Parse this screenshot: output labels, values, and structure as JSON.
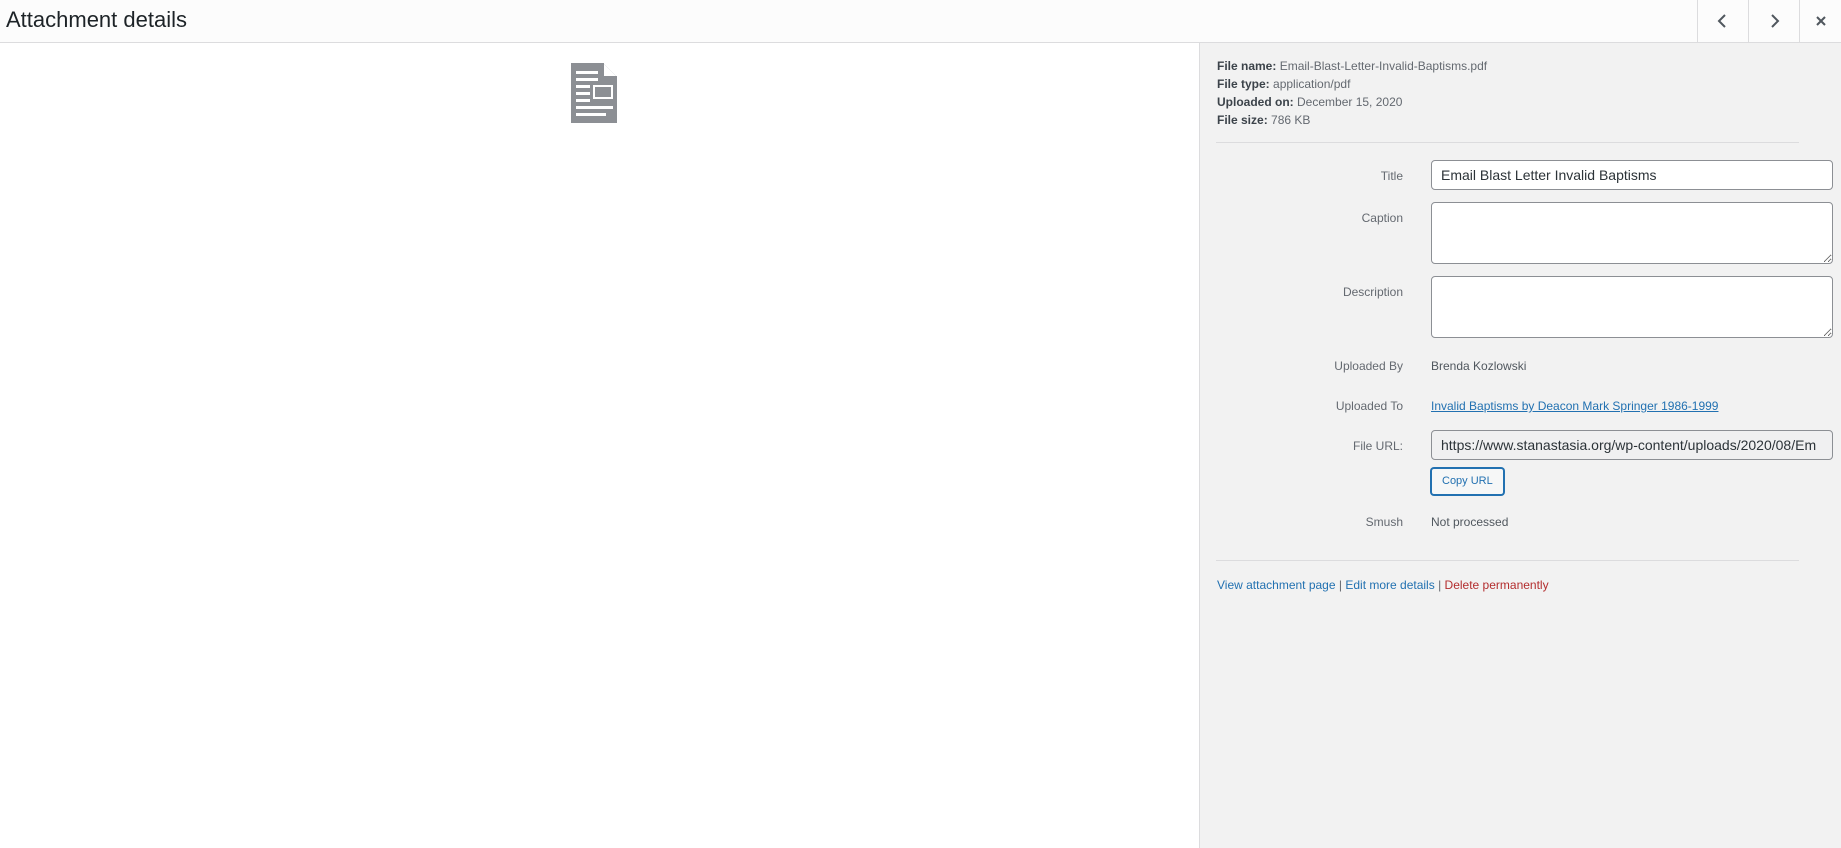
{
  "header": {
    "title": "Attachment details",
    "prev_icon": "chevron-left-icon",
    "next_icon": "chevron-right-icon",
    "close_icon": "close-icon"
  },
  "preview": {
    "icon": "document-icon"
  },
  "meta": {
    "file_name_label": "File name:",
    "file_name": "Email-Blast-Letter-Invalid-Baptisms.pdf",
    "file_type_label": "File type:",
    "file_type": "application/pdf",
    "uploaded_on_label": "Uploaded on:",
    "uploaded_on": "December 15, 2020",
    "file_size_label": "File size:",
    "file_size": "786 KB"
  },
  "fields": {
    "title_label": "Title",
    "title_value": "Email Blast Letter Invalid Baptisms",
    "caption_label": "Caption",
    "caption_value": "",
    "description_label": "Description",
    "description_value": "",
    "uploaded_by_label": "Uploaded By",
    "uploaded_by": "Brenda Kozlowski",
    "uploaded_to_label": "Uploaded To",
    "uploaded_to": "Invalid Baptisms by Deacon Mark Springer 1986-1999",
    "file_url_label": "File URL:",
    "file_url": "https://www.stanastasia.org/wp-content/uploads/2020/08/Em",
    "copy_url_label": "Copy URL",
    "smush_label": "Smush",
    "smush_value": "Not processed"
  },
  "actions": {
    "view_page": "View attachment page",
    "edit_more": "Edit more details",
    "delete": "Delete permanently",
    "divider": "|"
  },
  "colors": {
    "link": "#2271b1",
    "delete": "#b32d2e",
    "sidebar_bg": "#f2f2f2"
  }
}
